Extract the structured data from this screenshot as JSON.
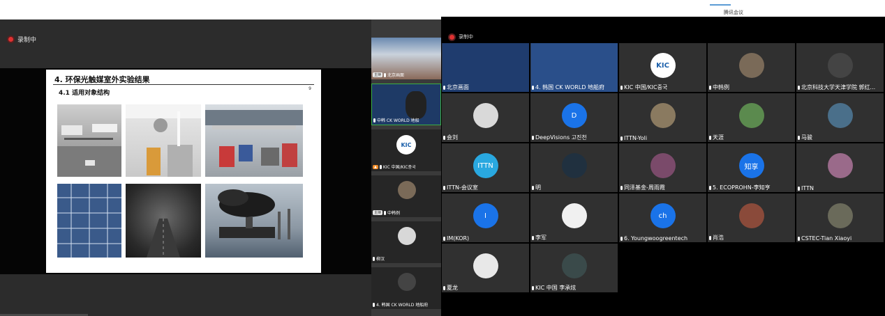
{
  "recording_label": "录制中",
  "meeting_title": "腾讯会议",
  "slide": {
    "title": "4. 环保光触媒室外实验结果",
    "subtitle": "4.1 适用对象结构",
    "page": "9"
  },
  "strip": [
    {
      "label": "北京画面",
      "tag": "主持"
    },
    {
      "label": "中韩 CK WORLD 地船",
      "tag": ""
    },
    {
      "label": "KIC 中国/KIC중국",
      "tag": ""
    },
    {
      "label": "中韩例",
      "tag": "主持"
    },
    {
      "label": "柳汉",
      "tag": ""
    },
    {
      "label": "4. 韩国 CK WORLD 地船府",
      "tag": ""
    }
  ],
  "gallery": [
    {
      "label": "北京画面",
      "avatar": "",
      "color": "#1f3c6e"
    },
    {
      "label": "4. 韩国 CK WORLD 地船府",
      "avatar": "",
      "color": "#2a4f8a"
    },
    {
      "label": "KIC 中国/KIC중국",
      "avatar": "KIC",
      "color": "#ffffff"
    },
    {
      "label": "中韩例",
      "avatar": "",
      "color": "#7a6a58"
    },
    {
      "label": "北京科技大学天津学院 郭红...",
      "avatar": "",
      "color": "#444"
    },
    {
      "label": "会刘",
      "avatar": "",
      "color": "#d9d9d9"
    },
    {
      "label": "DeepVisions 고진천",
      "avatar": "D",
      "color": "#1a73e8"
    },
    {
      "label": "ITTN-Yoli",
      "avatar": "",
      "color": "#8a7a60"
    },
    {
      "label": "天涯",
      "avatar": "",
      "color": "#5b8a4e"
    },
    {
      "label": "马骏",
      "avatar": "",
      "color": "#4a6f8a"
    },
    {
      "label": "ITTN-会议室",
      "avatar": "ITTN",
      "color": "#29a8e0"
    },
    {
      "label": "明",
      "avatar": "",
      "color": "#20303f"
    },
    {
      "label": "同泽基金-周雨霞",
      "avatar": "",
      "color": "#7a4a6a"
    },
    {
      "label": "5. ECOPROHN-李知亨",
      "avatar": "知享",
      "color": "#1a73e8"
    },
    {
      "label": "ITTN",
      "avatar": "",
      "color": "#9a6a8a"
    },
    {
      "label": "IM(KOR)",
      "avatar": "I",
      "color": "#1a73e8"
    },
    {
      "label": "李军",
      "avatar": "",
      "color": "#f0f0f0"
    },
    {
      "label": "6. Youngwoogreentech",
      "avatar": "ch",
      "color": "#1a73e8"
    },
    {
      "label": "肖浩",
      "avatar": "",
      "color": "#8a4a3a"
    },
    {
      "label": "CSTEC-Tian Xiaoyi",
      "avatar": "",
      "color": "#6a6a5a"
    },
    {
      "label": "夏龙",
      "avatar": "",
      "color": "#e8e8e8"
    },
    {
      "label": "KIC 中国 李承炫",
      "avatar": "",
      "color": "#3a4a4a"
    }
  ],
  "colors": {
    "mic": "#ffffff",
    "rec": "#e03131",
    "bg": "#303030"
  }
}
